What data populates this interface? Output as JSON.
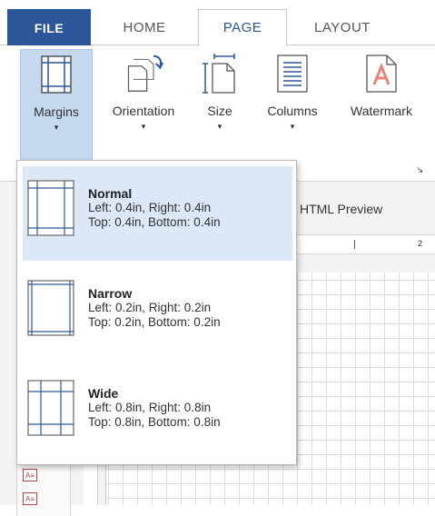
{
  "tabs": {
    "file": "FILE",
    "home": "HOME",
    "page": "PAGE",
    "layout": "LAYOUT"
  },
  "ribbon": {
    "margins": {
      "label": "Margins",
      "caret": "▾",
      "icon": "margins-icon"
    },
    "orientation": {
      "label": "Orientation",
      "caret": "▾",
      "icon": "orientation-icon"
    },
    "size": {
      "label": "Size",
      "caret": "▾",
      "icon": "size-icon"
    },
    "columns": {
      "label": "Columns",
      "caret": "▾",
      "icon": "columns-icon"
    },
    "watermark": {
      "label": "Watermark",
      "icon": "watermark-icon"
    },
    "launcher": "↘"
  },
  "editor": {
    "preview_tab": "HTML Preview",
    "ruler_number": "2"
  },
  "margins_menu": [
    {
      "title": "Normal",
      "line1": "Left: 0.4in, Right: 0.4in",
      "line2": "Top: 0.4in, Bottom: 0.4in",
      "selected": true
    },
    {
      "title": "Narrow",
      "line1": "Left: 0.2in, Right: 0.2in",
      "line2": "Top: 0.2in, Bottom: 0.2in",
      "selected": false
    },
    {
      "title": "Wide",
      "line1": "Left: 0.8in, Right: 0.8in",
      "line2": "Top: 0.8in, Bottom: 0.8in",
      "selected": false
    }
  ],
  "colors": {
    "accent": "#2b579a",
    "selected_bg": "#dde8f7",
    "button_active_bg": "#c5d9f1"
  }
}
